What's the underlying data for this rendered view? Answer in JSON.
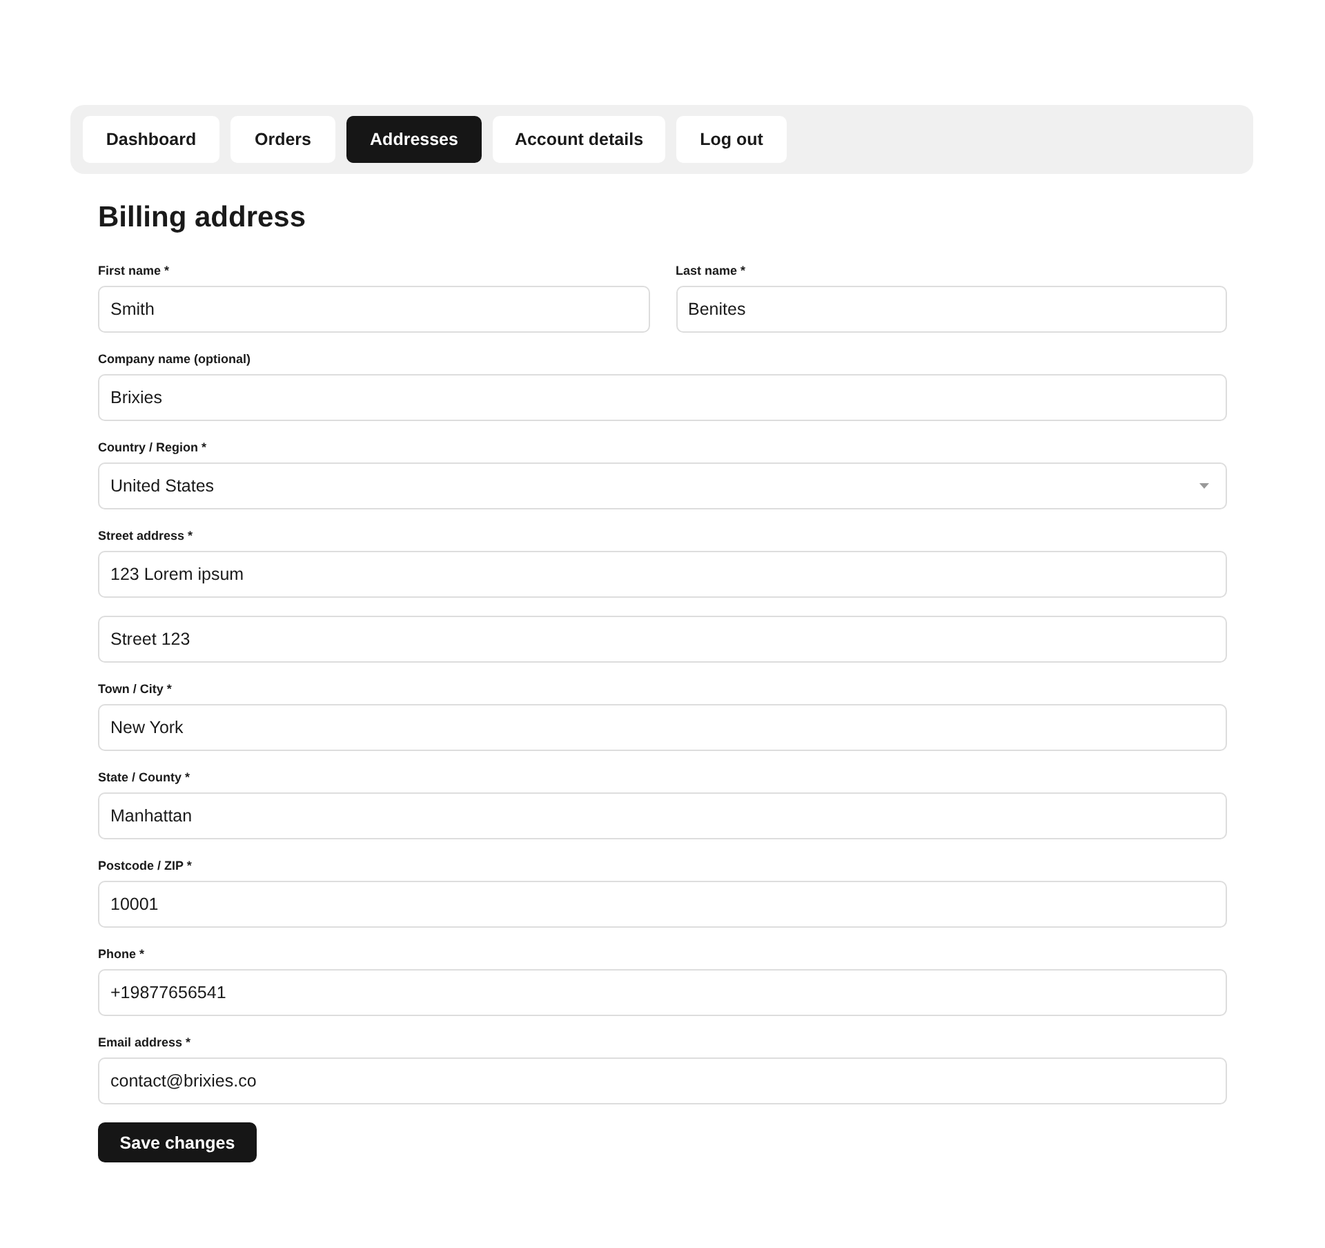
{
  "tabs": [
    {
      "label": "Dashboard",
      "selected": false
    },
    {
      "label": "Orders",
      "selected": false
    },
    {
      "label": "Addresses",
      "selected": true
    },
    {
      "label": "Account details",
      "selected": false
    },
    {
      "label": "Log out",
      "selected": false
    }
  ],
  "heading": "Billing address",
  "rows": [
    {
      "fields": [
        {
          "kind": "text",
          "label": "First name *",
          "value": "Smith"
        },
        {
          "kind": "text",
          "label": "Last name *",
          "value": "Benites"
        }
      ]
    },
    {
      "fields": [
        {
          "kind": "text",
          "label": "Company name (optional)",
          "value": "Brixies"
        }
      ]
    },
    {
      "fields": [
        {
          "kind": "select",
          "label": "Country / Region *",
          "value": "United States"
        }
      ]
    },
    {
      "fields": [
        {
          "kind": "text",
          "label": "Street address *",
          "value": "123 Lorem ipsum"
        }
      ]
    },
    {
      "fields": [
        {
          "kind": "text",
          "value": "Street 123"
        }
      ]
    },
    {
      "fields": [
        {
          "kind": "text",
          "label": "Town / City *",
          "value": "New York"
        }
      ]
    },
    {
      "fields": [
        {
          "kind": "text",
          "label": "State / County *",
          "value": "Manhattan"
        }
      ]
    },
    {
      "fields": [
        {
          "kind": "text",
          "label": "Postcode / ZIP *",
          "value": "10001"
        }
      ]
    },
    {
      "fields": [
        {
          "kind": "text",
          "label": "Phone *",
          "value": "+19877656541"
        }
      ]
    },
    {
      "fields": [
        {
          "kind": "text",
          "label": "Email address *",
          "value": "contact@brixies.co"
        }
      ]
    }
  ],
  "save_button": "Save changes"
}
